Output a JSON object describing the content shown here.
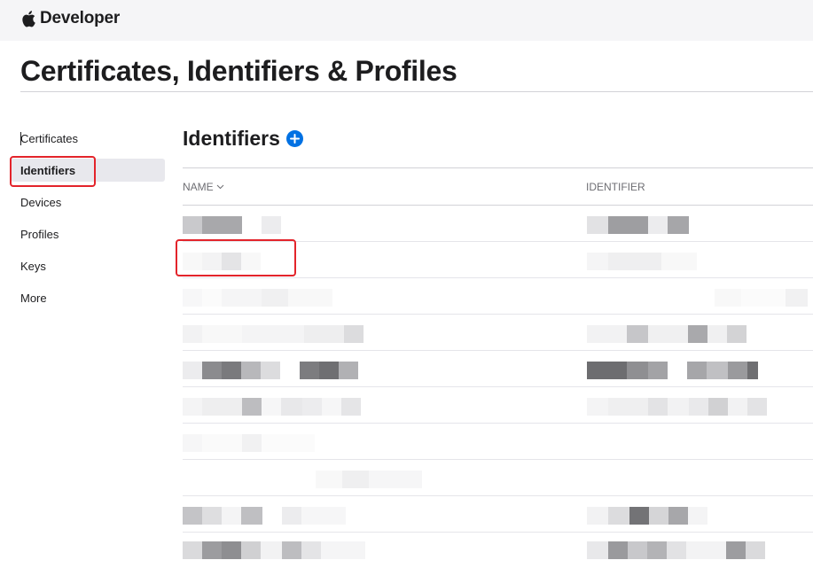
{
  "topbar": {
    "brand": "Developer",
    "logo_icon": "apple-logo-icon"
  },
  "page_title": "Certificates, Identifiers & Profiles",
  "sidebar": {
    "items": [
      {
        "label": "Certificates",
        "active": false
      },
      {
        "label": "Identifiers",
        "active": true
      },
      {
        "label": "Devices",
        "active": false
      },
      {
        "label": "Profiles",
        "active": false
      },
      {
        "label": "Keys",
        "active": false
      },
      {
        "label": "More",
        "active": false
      }
    ]
  },
  "section": {
    "title": "Identifiers",
    "add_icon": "plus-circle-icon"
  },
  "table": {
    "columns": {
      "name": "NAME",
      "identifier": "IDENTIFIER",
      "sort_icon": "chevron-down-icon"
    },
    "row_count": 10
  },
  "colors": {
    "accent": "#0071e3",
    "annotation": "#e3242b",
    "active_bg": "#e8e8ed"
  }
}
